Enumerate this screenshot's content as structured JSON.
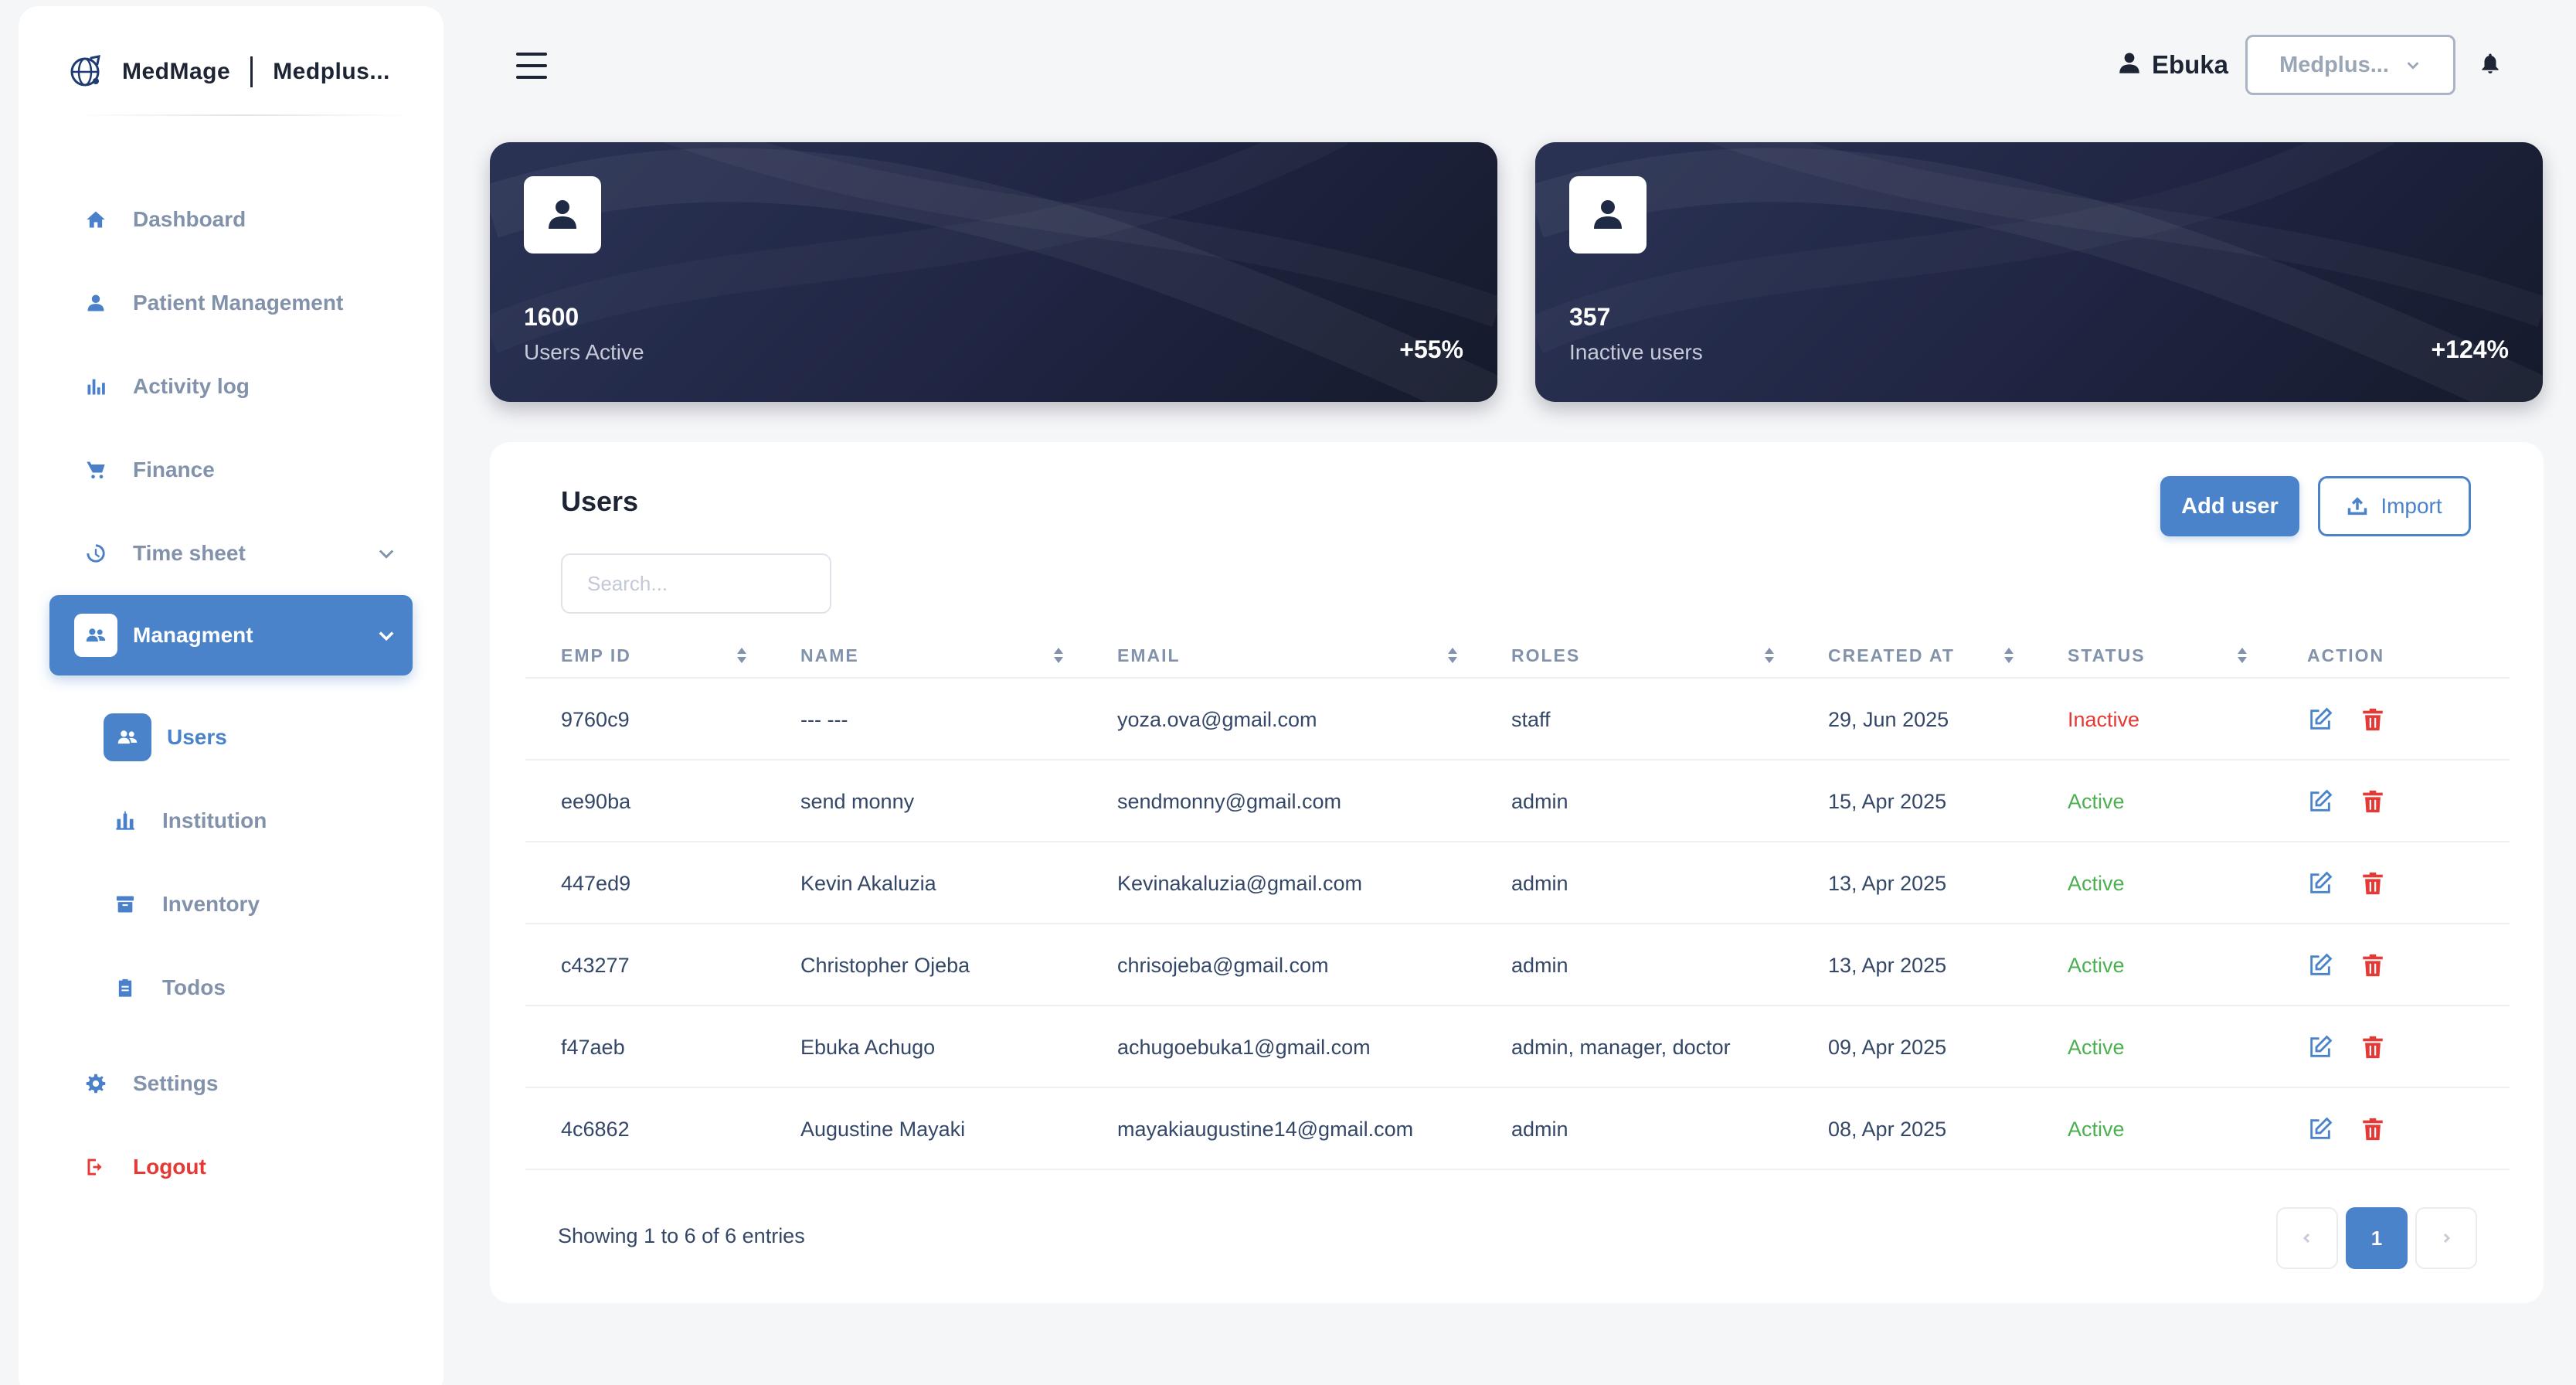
{
  "app": {
    "brand_name": "MedMage",
    "institution_short": "Medplus..."
  },
  "sidebar": {
    "items": [
      {
        "label": "Dashboard",
        "icon": "home-icon"
      },
      {
        "label": "Patient Management",
        "icon": "user-icon"
      },
      {
        "label": "Activity log",
        "icon": "bar-chart-icon"
      },
      {
        "label": "Finance",
        "icon": "cart-icon"
      },
      {
        "label": "Time sheet",
        "icon": "clock-icon"
      },
      {
        "label": "Managment",
        "icon": "users-group-icon"
      },
      {
        "label": "Users",
        "icon": "users-icon"
      },
      {
        "label": "Institution",
        "icon": "institution-icon"
      },
      {
        "label": "Inventory",
        "icon": "archive-icon"
      },
      {
        "label": "Todos",
        "icon": "clipboard-icon"
      },
      {
        "label": "Settings",
        "icon": "gear-icon"
      },
      {
        "label": "Logout",
        "icon": "logout-icon"
      }
    ]
  },
  "topbar": {
    "user_name": "Ebuka",
    "institution_select": "Medplus..."
  },
  "stats": [
    {
      "value": "1600",
      "label": "Users Active",
      "trend": "+55%"
    },
    {
      "value": "357",
      "label": "Inactive users",
      "trend": "+124%"
    }
  ],
  "users": {
    "title": "Users",
    "add_label": "Add user",
    "import_label": "Import",
    "search_placeholder": "Search...",
    "columns": [
      "EMP ID",
      "NAME",
      "EMAIL",
      "ROLES",
      "CREATED AT",
      "STATUS",
      "ACTION"
    ],
    "rows": [
      {
        "id": "9760c9",
        "name": "--- ---",
        "email": "yoza.ova@gmail.com",
        "roles": "staff",
        "created": "29, Jun 2025",
        "status": "Inactive"
      },
      {
        "id": "ee90ba",
        "name": "send monny",
        "email": "sendmonny@gmail.com",
        "roles": "admin",
        "created": "15, Apr 2025",
        "status": "Active"
      },
      {
        "id": "447ed9",
        "name": "Kevin Akaluzia",
        "email": "Kevinakaluzia@gmail.com",
        "roles": "admin",
        "created": "13, Apr 2025",
        "status": "Active"
      },
      {
        "id": "c43277",
        "name": "Christopher Ojeba",
        "email": "chrisojeba@gmail.com",
        "roles": "admin",
        "created": "13, Apr 2025",
        "status": "Active"
      },
      {
        "id": "f47aeb",
        "name": "Ebuka Achugo",
        "email": "achugoebuka1@gmail.com",
        "roles": "admin, manager, doctor",
        "created": "09, Apr 2025",
        "status": "Active"
      },
      {
        "id": "4c6862",
        "name": "Augustine Mayaki",
        "email": "mayakiaugustine14@gmail.com",
        "roles": "admin",
        "created": "08, Apr 2025",
        "status": "Active"
      }
    ],
    "showing": "Showing 1 to 6 of 6 entries",
    "current_page": "1"
  },
  "colors": {
    "accent": "#4a83c9",
    "card_dark": "#1f2542",
    "active": "#4caf50",
    "inactive": "#e53935",
    "muted": "#8392ab"
  }
}
